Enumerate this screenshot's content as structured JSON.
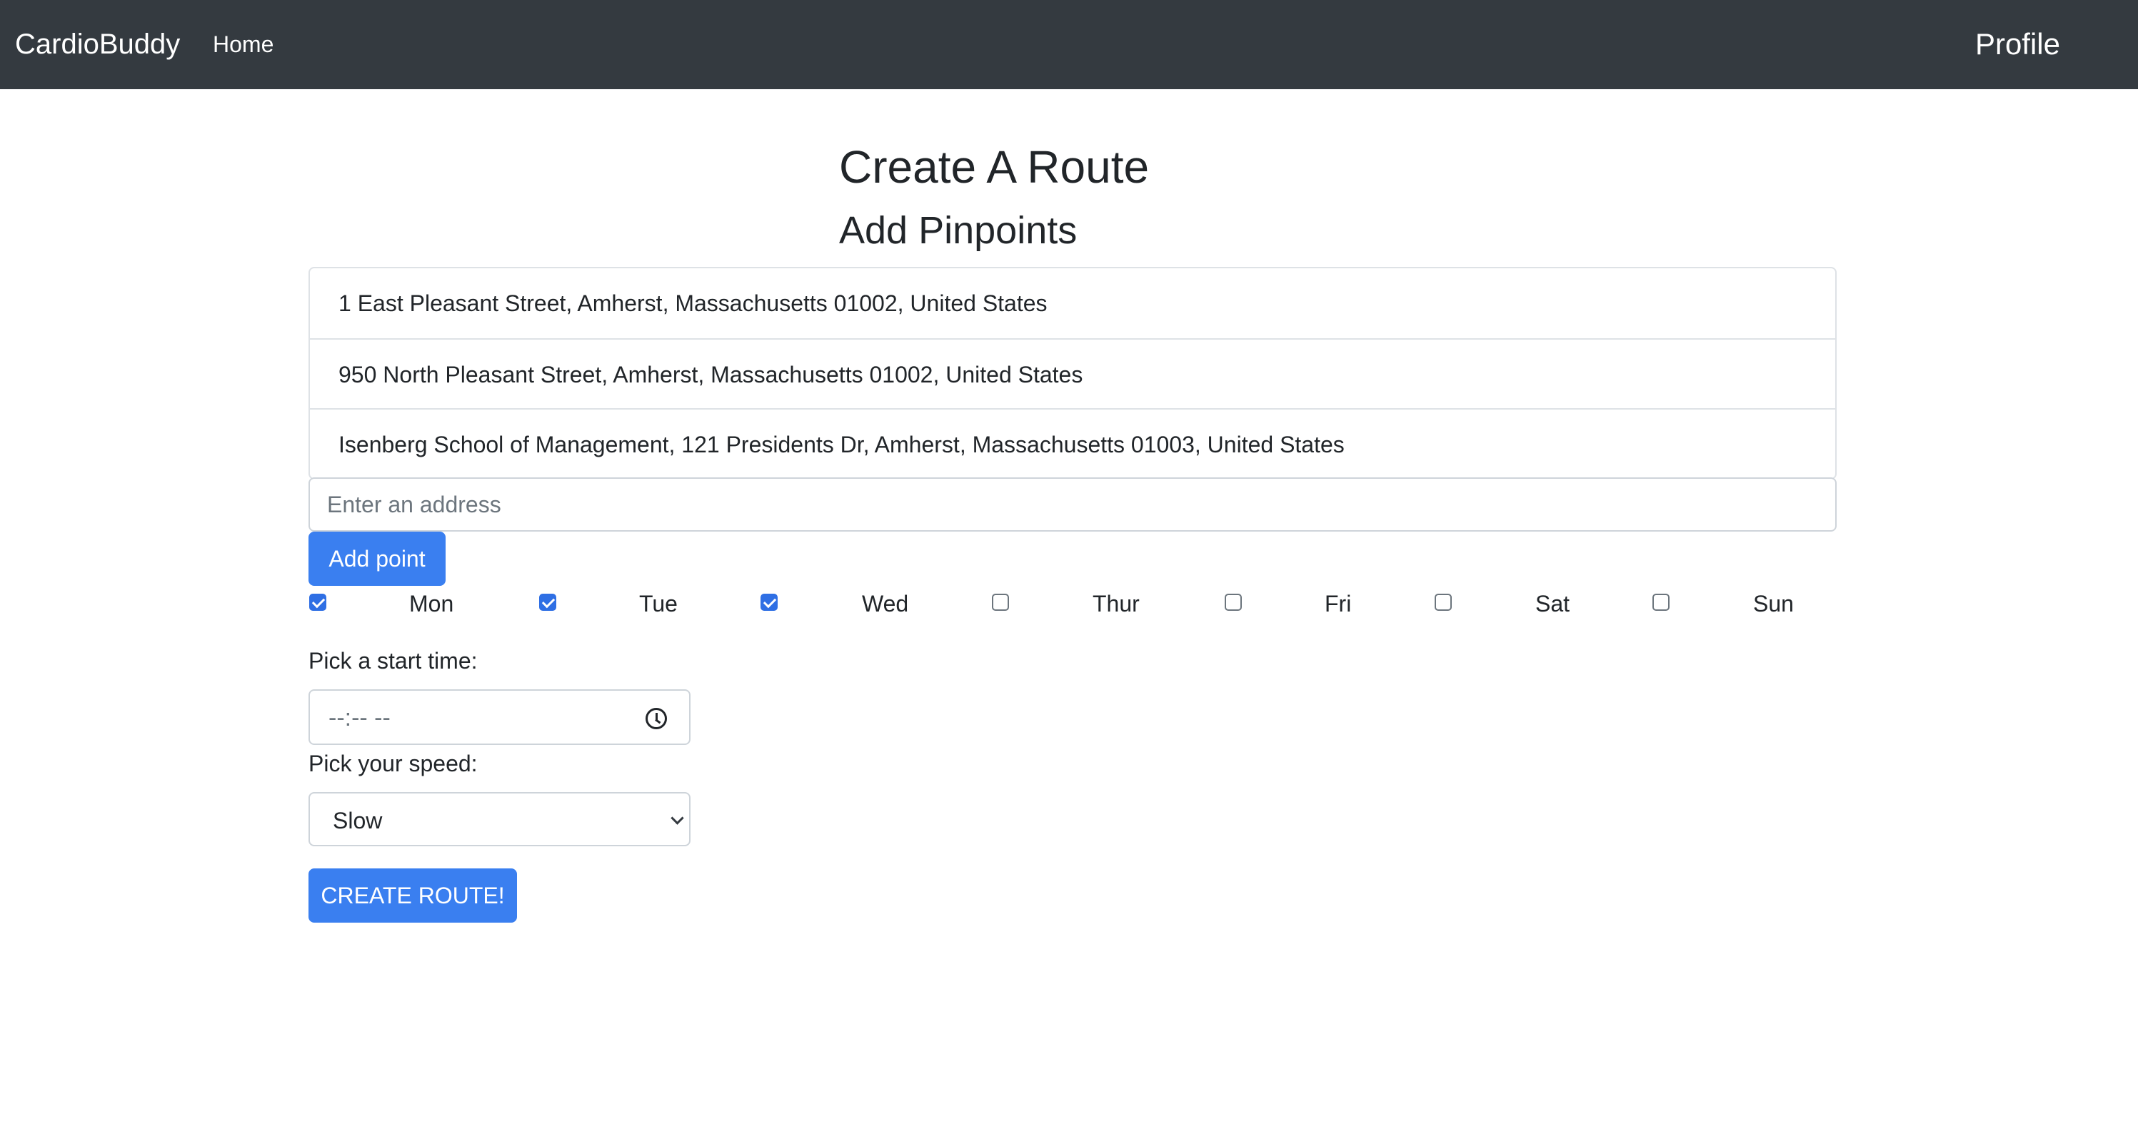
{
  "navbar": {
    "brand": "CardioBuddy",
    "home_label": "Home",
    "profile_label": "Profile"
  },
  "page": {
    "title": "Create A Route",
    "subtitle": "Add Pinpoints"
  },
  "pinpoints": [
    "1 East Pleasant Street, Amherst, Massachusetts 01002, United States",
    "950 North Pleasant Street, Amherst, Massachusetts 01002, United States",
    "Isenberg School of Management, 121 Presidents Dr, Amherst, Massachusetts 01003, United States"
  ],
  "address_input": {
    "placeholder": "Enter an address",
    "value": ""
  },
  "add_point_label": "Add point",
  "days": [
    {
      "label": "Mon",
      "checked": true
    },
    {
      "label": "Tue",
      "checked": true
    },
    {
      "label": "Wed",
      "checked": true
    },
    {
      "label": "Thur",
      "checked": false
    },
    {
      "label": "Fri",
      "checked": false
    },
    {
      "label": "Sat",
      "checked": false
    },
    {
      "label": "Sun",
      "checked": false
    }
  ],
  "start_time": {
    "label": "Pick a start time:",
    "value": "--:-- --",
    "icon": "clock-icon"
  },
  "speed": {
    "label": "Pick your speed:",
    "selected": "Slow",
    "icon": "chevron-down-icon"
  },
  "create_route_label": "CREATE ROUTE!",
  "colors": {
    "navbar_bg": "#343a40",
    "primary": "#3a7ff0",
    "checkbox_checked": "#2f6fe4",
    "border": "#dee2e6"
  }
}
